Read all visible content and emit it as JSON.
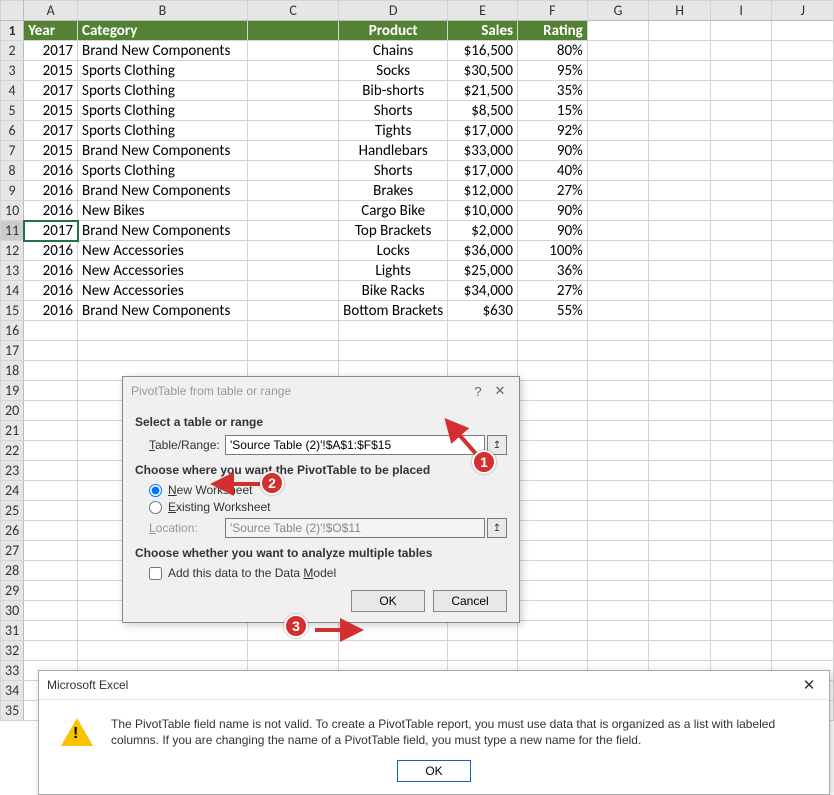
{
  "columns": [
    "A",
    "B",
    "C",
    "D",
    "E",
    "F",
    "G",
    "H",
    "I",
    "J"
  ],
  "colClasses": [
    "col-A",
    "col-B",
    "col-C",
    "col-D",
    "col-E",
    "col-F",
    "col-G",
    "col-H",
    "col-I",
    "col-J"
  ],
  "headers": {
    "year": "Year",
    "category": "Category",
    "product": "Product",
    "sales": "Sales",
    "rating": "Rating"
  },
  "rows": [
    {
      "year": "2017",
      "category": "Brand New Components",
      "product": "Chains",
      "sales": "$16,500",
      "rating": "80%"
    },
    {
      "year": "2015",
      "category": "Sports Clothing",
      "product": "Socks",
      "sales": "$30,500",
      "rating": "95%"
    },
    {
      "year": "2017",
      "category": "Sports Clothing",
      "product": "Bib-shorts",
      "sales": "$21,500",
      "rating": "35%"
    },
    {
      "year": "2015",
      "category": "Sports Clothing",
      "product": "Shorts",
      "sales": "$8,500",
      "rating": "15%"
    },
    {
      "year": "2017",
      "category": "Sports Clothing",
      "product": "Tights",
      "sales": "$17,000",
      "rating": "92%"
    },
    {
      "year": "2015",
      "category": "Brand New Components",
      "product": "Handlebars",
      "sales": "$33,000",
      "rating": "90%"
    },
    {
      "year": "2016",
      "category": "Sports Clothing",
      "product": "Shorts",
      "sales": "$17,000",
      "rating": "40%"
    },
    {
      "year": "2016",
      "category": "Brand New Components",
      "product": "Brakes",
      "sales": "$12,000",
      "rating": "27%"
    },
    {
      "year": "2016",
      "category": "New Bikes",
      "product": "Cargo Bike",
      "sales": "$10,000",
      "rating": "90%"
    },
    {
      "year": "2017",
      "category": "Brand New Components",
      "product": "Top Brackets",
      "sales": "$2,000",
      "rating": "90%"
    },
    {
      "year": "2016",
      "category": "New Accessories",
      "product": "Locks",
      "sales": "$36,000",
      "rating": "100%"
    },
    {
      "year": "2016",
      "category": "New Accessories",
      "product": "Lights",
      "sales": "$25,000",
      "rating": "36%"
    },
    {
      "year": "2016",
      "category": "New Accessories",
      "product": "Bike Racks",
      "sales": "$34,000",
      "rating": "27%"
    },
    {
      "year": "2016",
      "category": "Brand New Components",
      "product": "Bottom Brackets",
      "sales": "$630",
      "rating": "55%"
    }
  ],
  "blankRows": 20,
  "selectedRow": 11,
  "dialog1": {
    "title": "PivotTable from table or range",
    "sect1": "Select a table or range",
    "tableRangeLabel": "Table/Range:",
    "tableRangeValue": "'Source Table (2)'!$A$1:$F$15",
    "sect2": "Choose where you want the PivotTable to be placed",
    "newWorksheet": "New Worksheet",
    "existingWorksheet": "Existing Worksheet",
    "locationLabel": "Location:",
    "locationValue": "'Source Table (2)'!$O$11",
    "sect3": "Choose whether you want to analyze multiple tables",
    "dataModel": "Add this data to the Data Model",
    "ok": "OK",
    "cancel": "Cancel"
  },
  "dialog2": {
    "title": "Microsoft Excel",
    "message": "The PivotTable field name is not valid. To create a PivotTable report, you must use data that is organized as a list with labeled columns. If you are changing the name of a PivotTable field, you must type a new name for the field.",
    "ok": "OK"
  },
  "badges": {
    "b1": "1",
    "b2": "2",
    "b3": "3"
  }
}
